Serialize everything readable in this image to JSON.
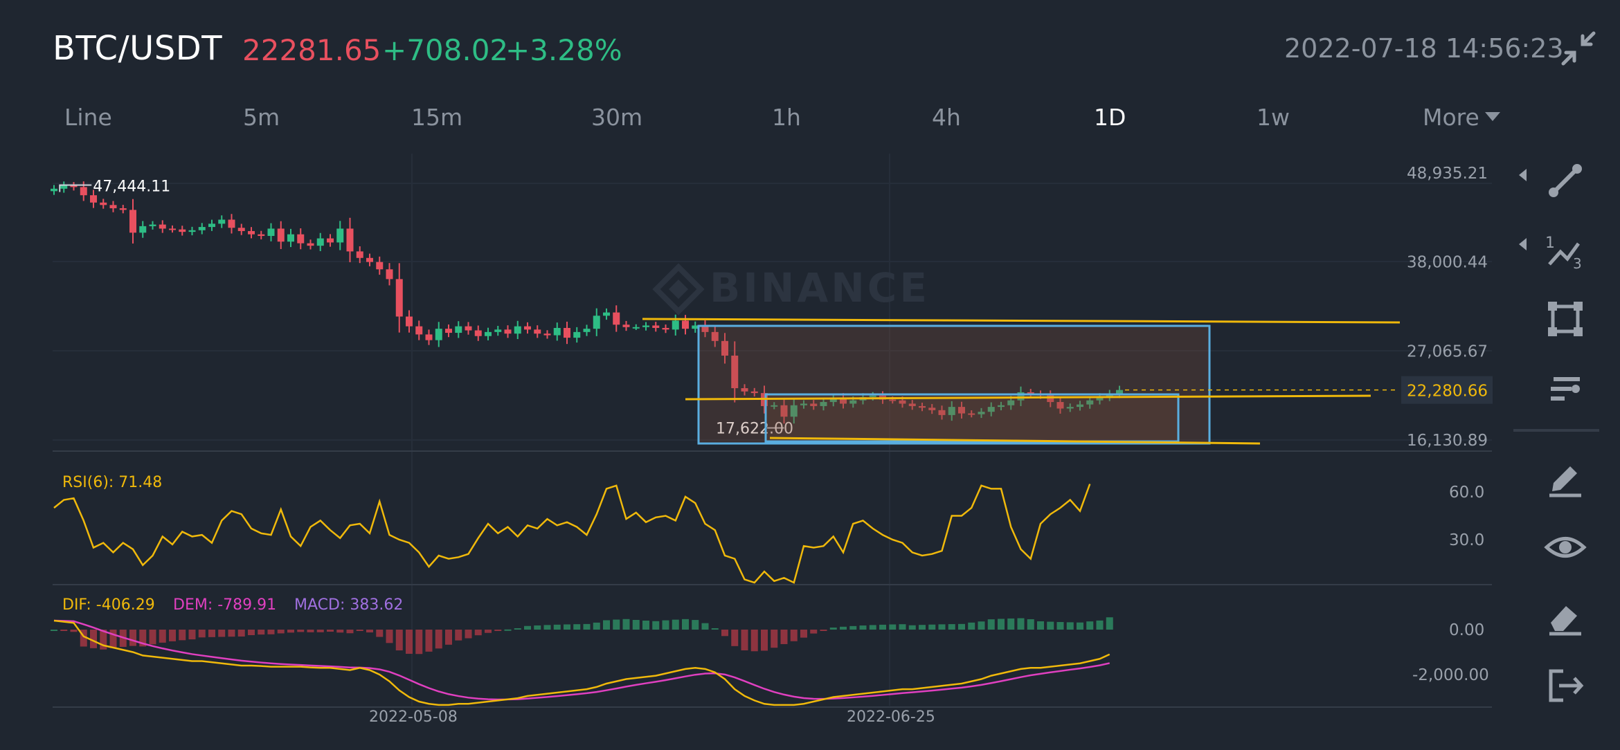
{
  "header": {
    "symbol": "BTC/USDT",
    "last_price": "22281.65",
    "change_abs": "+708.02",
    "change_pct": "+3.28%",
    "timestamp": "2022-07-18 14:56:23",
    "collapse_icon": "collapse-arrows-icon"
  },
  "intervals": [
    {
      "label": "Line",
      "active": false
    },
    {
      "label": "5m",
      "active": false
    },
    {
      "label": "15m",
      "active": false
    },
    {
      "label": "30m",
      "active": false
    },
    {
      "label": "1h",
      "active": false
    },
    {
      "label": "4h",
      "active": false
    },
    {
      "label": "1D",
      "active": true
    },
    {
      "label": "1w",
      "active": false
    },
    {
      "label": "More",
      "active": false
    }
  ],
  "toolbar": {
    "tools": [
      "trend-line-icon",
      "fibonacci-icon",
      "rectangle-icon",
      "position-icon",
      "pencil-icon",
      "eye-icon",
      "eraser-icon",
      "exit-icon"
    ]
  },
  "colors": {
    "background": "#1f2630",
    "up": "#2ebd85",
    "down": "#e8505f",
    "rsi": "#f0b90b",
    "dif": "#f0b90b",
    "dem": "#e040c0",
    "macd_label": "#a070e0",
    "drawing_rect": "#5aaee0",
    "drawing_line": "#f0b90b"
  },
  "watermark": "BINANCE",
  "chart_data": {
    "type": "candlestick",
    "price_axis": {
      "ticks": [
        {
          "value": 48935.21,
          "label": "48,935.21"
        },
        {
          "value": 38000.44,
          "label": "38,000.44"
        },
        {
          "value": 27065.67,
          "label": "27,065.67"
        },
        {
          "value": 16130.89,
          "label": "16,130.89"
        }
      ],
      "current_price_label": "22,280.66",
      "current_price": 22280.66
    },
    "date_labels": [
      "2022-05-08",
      "2022-06-25"
    ],
    "high_marker": {
      "label": "47,444.11",
      "value": 47444.11
    },
    "low_marker": {
      "label": "17,622.00",
      "value": 17622.0
    },
    "closes": [
      47000,
      47400,
      47200,
      46200,
      45300,
      45000,
      44600,
      44400,
      41600,
      42400,
      42600,
      42100,
      42000,
      41700,
      41900,
      42300,
      42700,
      43200,
      42200,
      41800,
      41400,
      41200,
      42100,
      40500,
      41400,
      40300,
      40000,
      40900,
      40400,
      42100,
      39300,
      38500,
      38000,
      37100,
      35900,
      31300,
      30100,
      29100,
      28400,
      29800,
      29300,
      30100,
      29600,
      28900,
      29400,
      29700,
      29200,
      30100,
      29700,
      29200,
      29000,
      29900,
      28700,
      29400,
      29800,
      31400,
      31800,
      30300,
      30000,
      30000,
      30200,
      29900,
      29700,
      30800,
      29800,
      30200,
      29400,
      28300,
      26500,
      22500,
      22100,
      21900,
      20300,
      20400,
      19000,
      20400,
      20600,
      20300,
      20800,
      21300,
      20600,
      21000,
      21400,
      21600,
      21100,
      21000,
      20600,
      20300,
      20100,
      19800,
      19200,
      20200,
      19400,
      19300,
      19600,
      20200,
      20400,
      21000,
      22000,
      21800,
      21600,
      20800,
      20000,
      20200,
      20500,
      21000,
      21400,
      21800,
      22280
    ],
    "rsi": {
      "label": "RSI(6): 71.48",
      "value": 71.48,
      "ticks": [
        {
          "value": 60,
          "label": "60.0"
        },
        {
          "value": 30,
          "label": "30.0"
        }
      ],
      "values": [
        50,
        55,
        56,
        42,
        25,
        28,
        22,
        28,
        24,
        14,
        20,
        32,
        27,
        35,
        32,
        33,
        28,
        42,
        48,
        46,
        37,
        34,
        33,
        49,
        32,
        26,
        38,
        42,
        36,
        31,
        39,
        40,
        34,
        54,
        33,
        30,
        28,
        22,
        13,
        20,
        18,
        19,
        21,
        31,
        40,
        34,
        38,
        32,
        39,
        37,
        43,
        39,
        41,
        38,
        33,
        46,
        62,
        64,
        43,
        47,
        41,
        44,
        45,
        42,
        57,
        53,
        40,
        36,
        20,
        18,
        5,
        3,
        10,
        4,
        6,
        3,
        26,
        25,
        26,
        32,
        22,
        40,
        42,
        37,
        33,
        30,
        28,
        22,
        20,
        21,
        23,
        45,
        45,
        50,
        64,
        62,
        62,
        38,
        24,
        18,
        40,
        46,
        50,
        55,
        48,
        65
      ]
    },
    "macd": {
      "dif_label": "DIF: -406.29",
      "dem_label": "DEM: -789.91",
      "macd_label": "MACD: 383.62",
      "ticks": [
        {
          "value": 0,
          "label": "0.00"
        },
        {
          "value": -2000,
          "label": "-2,000.00"
        }
      ],
      "dif": [
        400,
        350,
        300,
        -300,
        -500,
        -700,
        -800,
        -900,
        -1000,
        -1150,
        -1200,
        -1250,
        -1300,
        -1350,
        -1400,
        -1400,
        -1450,
        -1500,
        -1550,
        -1600,
        -1600,
        -1620,
        -1650,
        -1650,
        -1650,
        -1650,
        -1680,
        -1700,
        -1700,
        -1750,
        -1800,
        -1700,
        -1800,
        -2000,
        -2300,
        -2700,
        -3000,
        -3200,
        -3300,
        -3350,
        -3350,
        -3300,
        -3300,
        -3250,
        -3200,
        -3150,
        -3100,
        -3050,
        -2950,
        -2900,
        -2850,
        -2800,
        -2750,
        -2700,
        -2650,
        -2550,
        -2400,
        -2300,
        -2200,
        -2150,
        -2100,
        -2050,
        -1950,
        -1850,
        -1750,
        -1700,
        -1750,
        -1900,
        -2200,
        -2650,
        -2950,
        -3150,
        -3300,
        -3350,
        -3350,
        -3350,
        -3300,
        -3200,
        -3100,
        -3000,
        -2950,
        -2900,
        -2850,
        -2800,
        -2750,
        -2700,
        -2650,
        -2650,
        -2600,
        -2550,
        -2500,
        -2450,
        -2400,
        -2300,
        -2200,
        -2050,
        -1950,
        -1850,
        -1750,
        -1700,
        -1700,
        -1650,
        -1600,
        -1550,
        -1500,
        -1400,
        -1300,
        -1100
      ]
    }
  }
}
